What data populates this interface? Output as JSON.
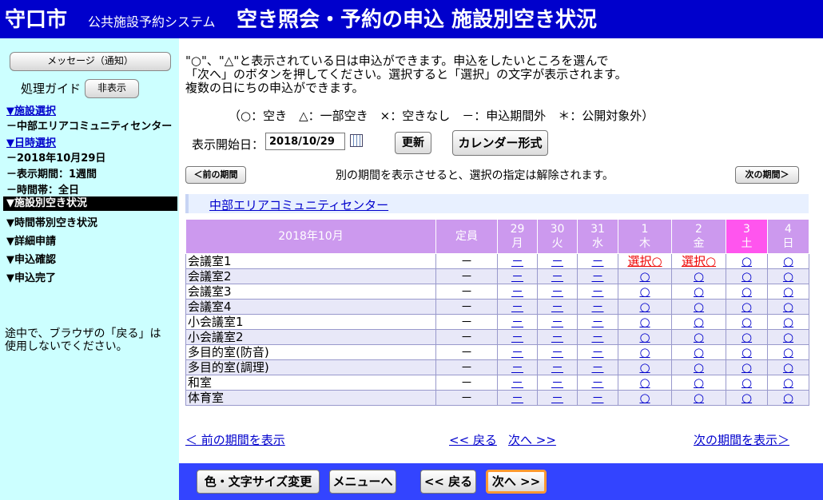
{
  "header": {
    "city": "守口市",
    "system": "公共施設予約システム",
    "title": "空き照会・予約の申込 施設別空き状況"
  },
  "sidebar": {
    "message_button": "メッセージ（通知）",
    "guide_label": "処理ガイド",
    "guide_toggle": "非表示",
    "step_facility": "▼施設選択",
    "facility_value": "－中部エリアコミュニティセンター",
    "step_datetime": "▼日時選択",
    "date_value": "－2018年10月29日",
    "period_value": "－表示期間：1週間",
    "timeslot_value": "－時間帯：全日",
    "step_active": "▼施設別空き状況",
    "step_timeslot": "▼時間帯別空き状況",
    "step_detail": "▼詳細申請",
    "step_confirm": "▼申込確認",
    "step_done": "▼申込完了",
    "note_line1": "途中で、ブラウザの「戻る」は",
    "note_line2": "使用しないでください。"
  },
  "intro": {
    "line1": "\"○\"、\"△\"と表示されている日は申込ができます。申込をしたいところを選んで",
    "line2": "「次へ」のボタンを押してください。選択すると「選択」の文字が表示されます。",
    "line3": "複数の日にちの申込ができます。",
    "legend": "（○：空き　△：一部空き　×：空きなし　－：申込期間外　＊：公開対象外）"
  },
  "controls": {
    "start_label": "表示開始日：",
    "start_value": "2018/10/29",
    "refresh": "更新",
    "calendar": "カレンダー形式",
    "prev_period": "＜前の期間",
    "next_period": "次の期間＞",
    "period_note": "別の期間を表示させると、選択の指定は解除されます。"
  },
  "facility": "中部エリアコミュニティセンター",
  "table": {
    "month": "2018年10月",
    "capacity_header": "定員",
    "days": [
      {
        "d": "29",
        "w": "月"
      },
      {
        "d": "30",
        "w": "火"
      },
      {
        "d": "31",
        "w": "水"
      },
      {
        "d": "1",
        "w": "木"
      },
      {
        "d": "2",
        "w": "金"
      },
      {
        "d": "3",
        "w": "土"
      },
      {
        "d": "4",
        "w": "日"
      }
    ],
    "rows": [
      {
        "room": "会議室1",
        "cap": "－",
        "cells": [
          "－",
          "－",
          "－",
          "選択○",
          "選択○",
          "○",
          "○"
        ]
      },
      {
        "room": "会議室2",
        "cap": "－",
        "cells": [
          "－",
          "－",
          "－",
          "○",
          "○",
          "○",
          "○"
        ]
      },
      {
        "room": "会議室3",
        "cap": "－",
        "cells": [
          "－",
          "－",
          "－",
          "○",
          "○",
          "○",
          "○"
        ]
      },
      {
        "room": "会議室4",
        "cap": "－",
        "cells": [
          "－",
          "－",
          "－",
          "○",
          "○",
          "○",
          "○"
        ]
      },
      {
        "room": "小会議室1",
        "cap": "－",
        "cells": [
          "－",
          "－",
          "－",
          "○",
          "○",
          "○",
          "○"
        ]
      },
      {
        "room": "小会議室2",
        "cap": "－",
        "cells": [
          "－",
          "－",
          "－",
          "○",
          "○",
          "○",
          "○"
        ]
      },
      {
        "room": "多目的室(防音)",
        "cap": "－",
        "cells": [
          "－",
          "－",
          "－",
          "○",
          "○",
          "○",
          "○"
        ]
      },
      {
        "room": "多目的室(調理)",
        "cap": "－",
        "cells": [
          "－",
          "－",
          "－",
          "○",
          "○",
          "○",
          "○"
        ]
      },
      {
        "room": "和室",
        "cap": "－",
        "cells": [
          "－",
          "－",
          "－",
          "○",
          "○",
          "○",
          "○"
        ]
      },
      {
        "room": "体育室",
        "cap": "－",
        "cells": [
          "－",
          "－",
          "－",
          "○",
          "○",
          "○",
          "○"
        ]
      }
    ]
  },
  "bottom_links": {
    "prev_period": "＜ 前の期間を表示",
    "back": "<< 戻る",
    "forward": "次へ >>",
    "next_period": "次の期間を表示＞"
  },
  "footer": {
    "color_size": "色・文字サイズ変更",
    "menu": "メニューへ",
    "back": "<< 戻る",
    "next": "次へ >>"
  },
  "colors": {
    "header_bg": "#0000cc",
    "sidebar_bg": "#ccffff",
    "table_header_bg": "#cc99ee",
    "saturday_bg": "#ff55ee",
    "footer_bg": "#3344ff",
    "selected_text": "#ee0000"
  },
  "icons": {
    "calendar": "calendar-icon"
  }
}
